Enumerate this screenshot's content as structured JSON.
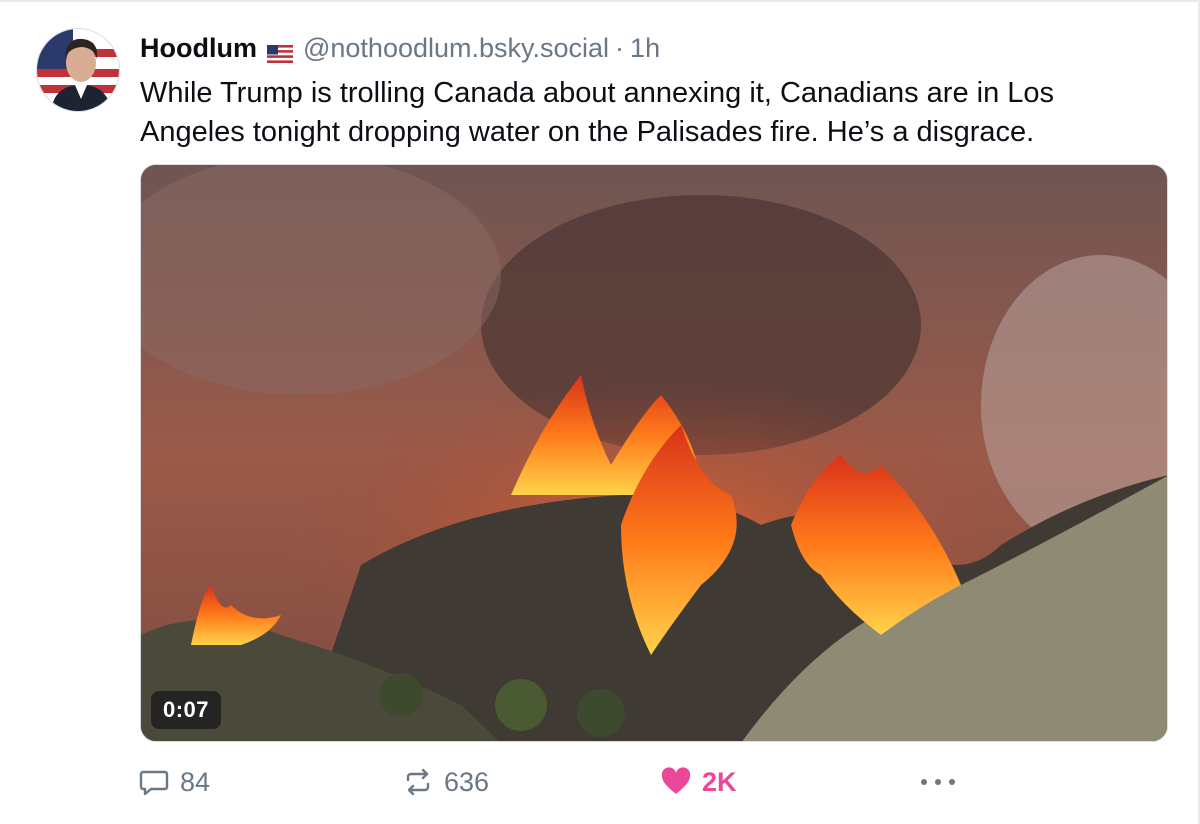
{
  "post": {
    "author_name": "Hoodlum",
    "flag_icon": "us-flag-icon",
    "handle": "@nothoodlum.bsky.social",
    "separator": "·",
    "time": "1h",
    "text": "While Trump is trolling Canada about annexing it, Canadians are in Los Angeles tonight dropping water on the Palisades fire. He’s a disgrace."
  },
  "media": {
    "duration": "0:07"
  },
  "actions": {
    "reply_icon": "reply-icon",
    "reply_count": "84",
    "repost_icon": "repost-icon",
    "repost_count": "636",
    "like_icon": "heart-icon",
    "like_count": "2K",
    "like_color": "#ec4899",
    "more_icon": "more-icon"
  }
}
